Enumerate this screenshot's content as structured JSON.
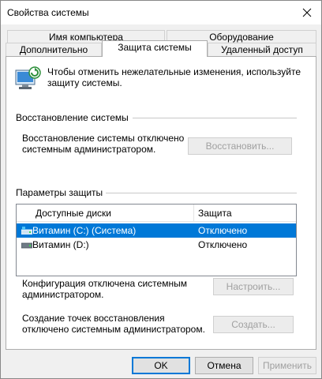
{
  "window": {
    "title": "Свойства системы"
  },
  "tabs": {
    "row1": [
      "Имя компьютера",
      "Оборудование"
    ],
    "row2": [
      "Дополнительно",
      "Защита системы",
      "Удаленный доступ"
    ],
    "active": "Защита системы"
  },
  "intro": {
    "text": "Чтобы отменить нежелательные изменения, используйте защиту системы."
  },
  "restore": {
    "group_title": "Восстановление системы",
    "text": "Восстановление системы отключено системным администратором.",
    "button": "Восстановить..."
  },
  "protection": {
    "group_title": "Параметры защиты",
    "columns": [
      "Доступные диски",
      "Защита"
    ],
    "rows": [
      {
        "drive": "Витамин (C:) (Система)",
        "status": "Отключено",
        "selected": true,
        "icon": "system-drive-icon"
      },
      {
        "drive": "Витамин (D:)",
        "status": "Отключено",
        "selected": false,
        "icon": "drive-icon"
      }
    ],
    "config_text": "Конфигурация отключена системным администратором.",
    "config_button": "Настроить...",
    "create_text": "Создание точек восстановления отключено системным администратором.",
    "create_button": "Создать..."
  },
  "footer": {
    "ok": "OK",
    "cancel": "Отмена",
    "apply": "Применить"
  },
  "colors": {
    "selection": "#0078d7",
    "disabled_text": "#a0a0a0"
  }
}
